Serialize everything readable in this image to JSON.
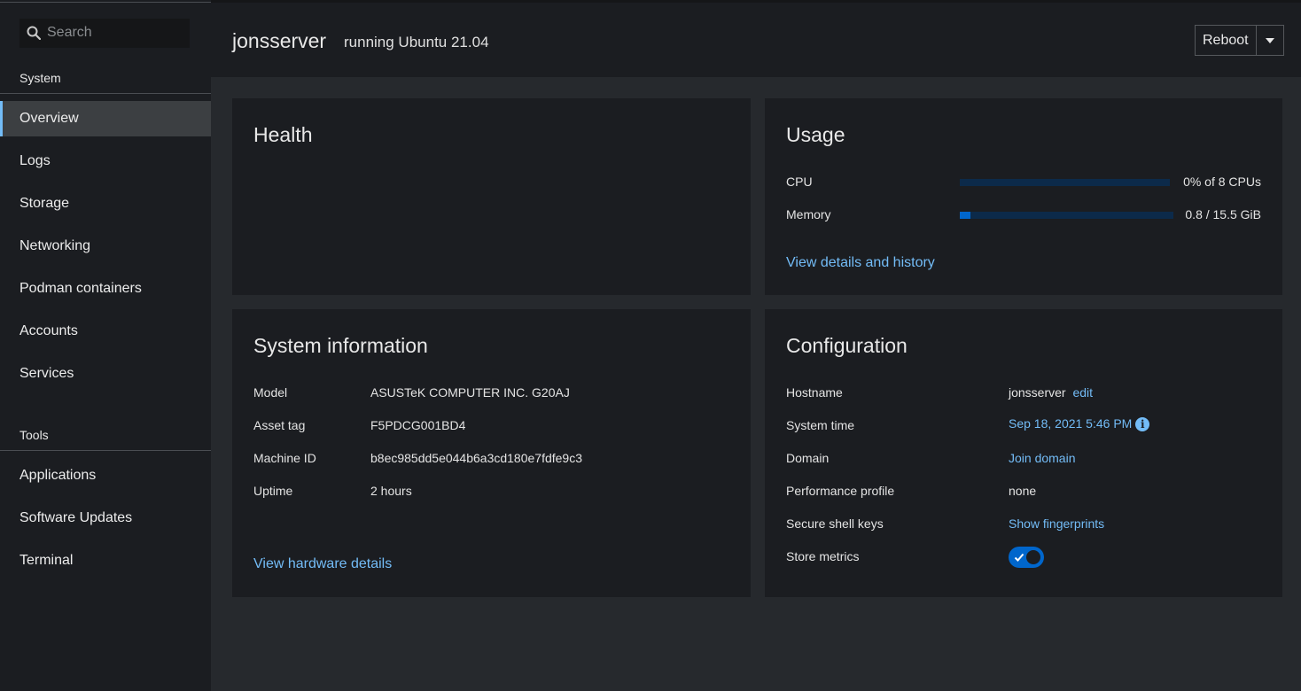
{
  "sidebar": {
    "search_placeholder": "Search",
    "system_title": "System",
    "tools_title": "Tools",
    "system_items": [
      {
        "label": "Overview",
        "active": true
      },
      {
        "label": "Logs"
      },
      {
        "label": "Storage"
      },
      {
        "label": "Networking"
      },
      {
        "label": "Podman containers"
      },
      {
        "label": "Accounts"
      },
      {
        "label": "Services"
      }
    ],
    "tools_items": [
      {
        "label": "Applications"
      },
      {
        "label": "Software Updates"
      },
      {
        "label": "Terminal"
      }
    ]
  },
  "header": {
    "hostname": "jonsserver",
    "subtitle": "running Ubuntu 21.04",
    "reboot_label": "Reboot"
  },
  "health": {
    "title": "Health"
  },
  "usage": {
    "title": "Usage",
    "cpu_label": "CPU",
    "cpu_value": "0% of 8 CPUs",
    "cpu_fraction": 0.0,
    "memory_label": "Memory",
    "memory_value": "0.8 / 15.5 GiB",
    "memory_fraction": 0.05,
    "link": "View details and history"
  },
  "sysinfo": {
    "title": "System information",
    "rows": [
      {
        "label": "Model",
        "value": "ASUSTeK COMPUTER INC. G20AJ"
      },
      {
        "label": "Asset tag",
        "value": "F5PDCG001BD4"
      },
      {
        "label": "Machine ID",
        "value": "b8ec985dd5e044b6a3cd180e7fdfe9c3"
      },
      {
        "label": "Uptime",
        "value": "2 hours"
      }
    ],
    "link": "View hardware details"
  },
  "config": {
    "title": "Configuration",
    "hostname_label": "Hostname",
    "hostname_value": "jonsserver",
    "hostname_edit": "edit",
    "time_label": "System time",
    "time_value": "Sep 18, 2021 5:46 PM",
    "domain_label": "Domain",
    "domain_value": "Join domain",
    "perf_label": "Performance profile",
    "perf_value": "none",
    "ssh_label": "Secure shell keys",
    "ssh_value": "Show fingerprints",
    "metrics_label": "Store metrics",
    "metrics_enabled": true
  },
  "colors": {
    "accent": "#73bcf7",
    "primary": "#0066cc"
  }
}
